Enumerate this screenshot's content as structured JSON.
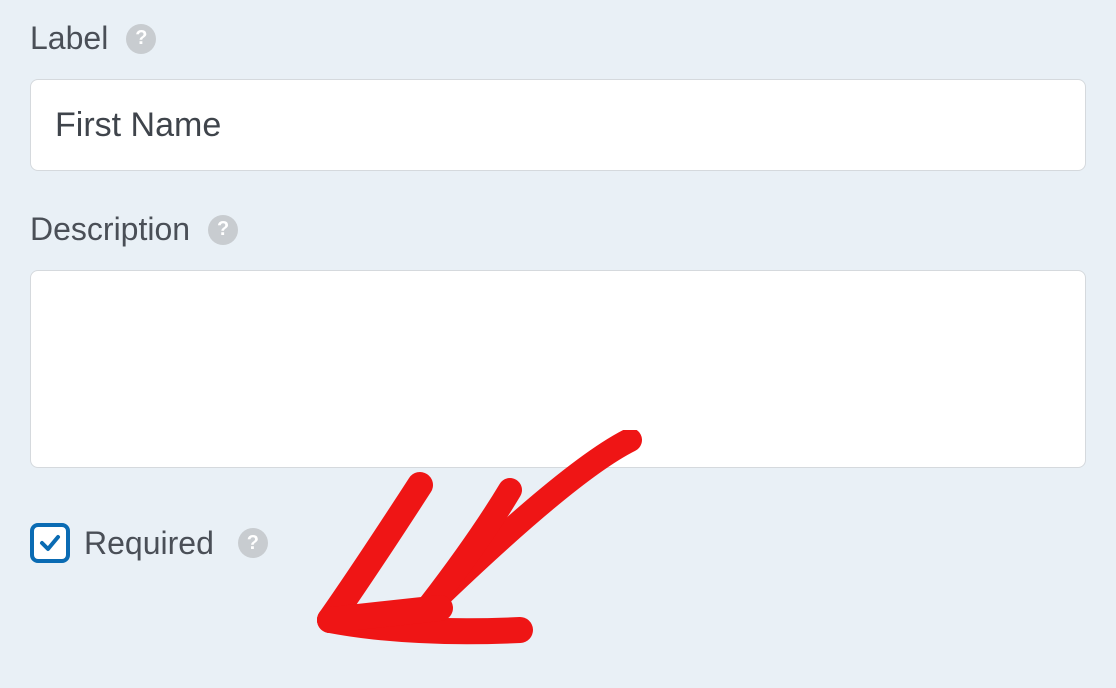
{
  "fields": {
    "label": {
      "title": "Label",
      "value": "First Name"
    },
    "description": {
      "title": "Description",
      "value": ""
    },
    "required": {
      "title": "Required",
      "checked": true
    }
  }
}
